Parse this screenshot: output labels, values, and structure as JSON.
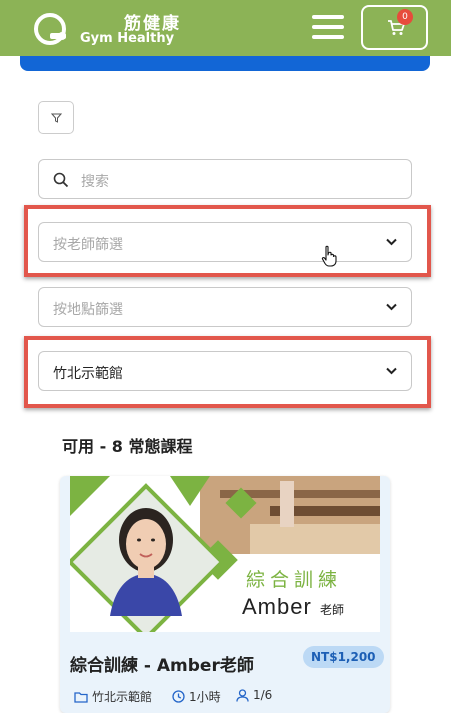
{
  "header": {
    "brand_cn": "筋健康",
    "brand_en": "Gym Healthy",
    "cart_count": "0",
    "colors": {
      "brand_green": "#8cb356",
      "accent_blue": "#1266d6",
      "highlight_red": "#e2574c"
    }
  },
  "filters": {
    "search_placeholder": "搜索",
    "teacher_placeholder": "按老師篩選",
    "location_placeholder": "按地點篩選",
    "studio_value": "竹北示範館"
  },
  "section": {
    "title": "可用 - 8 常態課程"
  },
  "card": {
    "banner_heading": "綜合訓練",
    "banner_name": "Amber",
    "banner_suffix": "老師",
    "title": "綜合訓練 - Amber老師",
    "price": "NT$1,200",
    "location": "竹北示範館",
    "duration": "1小時",
    "capacity": "1/6"
  },
  "icons": [
    "logo-mark-icon",
    "hamburger-icon",
    "cart-icon",
    "filter-icon",
    "search-icon",
    "chevron-down-icon",
    "pointer-cursor-icon",
    "folder-icon",
    "clock-icon",
    "person-icon"
  ]
}
